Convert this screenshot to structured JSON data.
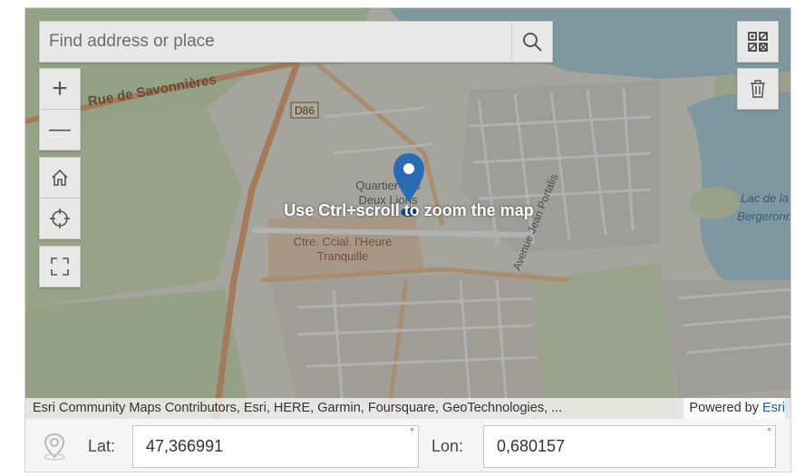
{
  "search": {
    "placeholder": "Find address or place"
  },
  "controls": {
    "zoom_in": "+",
    "zoom_out": "—"
  },
  "map": {
    "overlay_hint": "Use Ctrl+scroll to zoom the map",
    "labels": {
      "street_savonnieres": "Rue de Savonnières",
      "road_d86": "D86",
      "quartier": "Quartier des",
      "deux_lions": "Deux Lions",
      "centre_line1": "Ctre. Ccial. l'Heure",
      "centre_line2": "Tranquille",
      "avenue": "Avenue Jean Portalis",
      "lac_line1": "Lac de la",
      "lac_line2": "Bergeronn"
    },
    "attribution": "Esri Community Maps Contributors, Esri, HERE, Garmin, Foursquare, GeoTechnologies, ...",
    "powered_by": "Powered by",
    "powered_link": "Esri"
  },
  "coords": {
    "lat_label": "Lat:",
    "lat_value": "47,366991",
    "lon_label": "Lon:",
    "lon_value": "0,680157",
    "degree": "°"
  },
  "colors": {
    "marker": "#2a6bb3",
    "water": "#aad3df",
    "road_major": "#e9a36a"
  }
}
